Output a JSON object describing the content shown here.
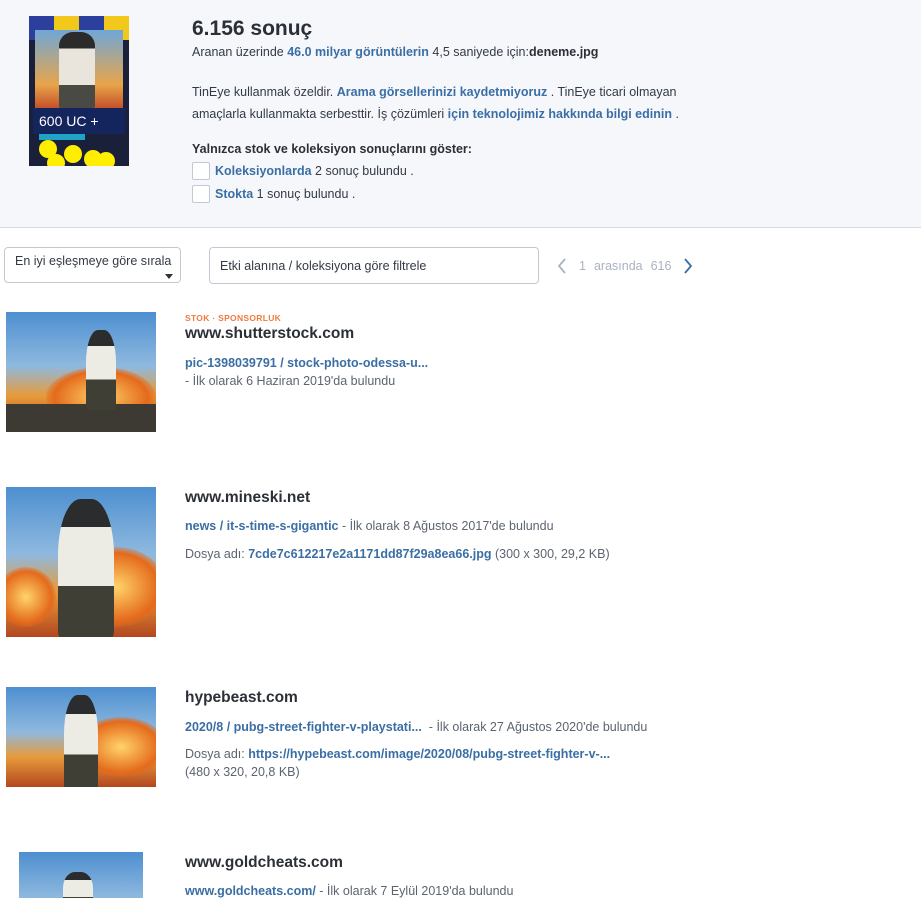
{
  "header": {
    "result_count": "6.156 sonuç",
    "searched_prefix": "Aranan üzerinde ",
    "searched_count": "46.0 milyar görüntülerin",
    "searched_suffix": " 4,5 saniyede için:",
    "query_file": "deneme.jpg",
    "query_thumb": {
      "price_text": "600 UC + ",
      "colors": {
        "dots": "#ffee00",
        "banner": "#14245c"
      }
    },
    "notice_1": "TinEye kullanmak özeldir. ",
    "notice_link_1": "Arama görsellerinizi kaydetmiyoruz",
    "notice_2": " . TinEye ticari olmayan amaçlarla kullanmakta serbesttir. İş çözümleri ",
    "notice_link_2": "için teknolojimiz hakkında bilgi edinin",
    "notice_3": " .",
    "stock_title": "Yalnızca stok ve koleksiyon sonuçlarını göster:",
    "filters": [
      {
        "link": "Koleksiyonlarda",
        "text": " 2 sonuç bulundu ."
      },
      {
        "link": "Stokta",
        "text": " 1 sonuç bulundu ."
      }
    ]
  },
  "toolbar": {
    "sort_label": "En iyi eşleşmeye göre sırala",
    "filter_placeholder": "Etki alanına / koleksiyona göre filtrele",
    "pager": {
      "current": "1",
      "between": "arasında",
      "total": "616"
    }
  },
  "results": [
    {
      "tags": "STOK · SPONSORLUK",
      "domain": "www.shutterstock.com",
      "link": "pic-1398039791 / stock-photo-odessa-u...",
      "found": "- İlk olarak 6 Haziran 2019'da bulundu"
    },
    {
      "domain": "www.mineski.net",
      "link": "news / it-s-time-s-gigantic",
      "found": " - İlk olarak 8 Ağustos 2017'de bulundu",
      "file_prefix": "Dosya adı: ",
      "file_name": "7cde7c612217e2a1171dd87f29a8ea66.jpg",
      "file_info": " (300 x 300, 29,2 KB)"
    },
    {
      "domain": "hypebeast.com",
      "link": "2020/8 / pubg-street-fighter-v-playstati...",
      "found": "  - İlk olarak 27 Ağustos 2020'de bulundu",
      "file_prefix": "Dosya adı: ",
      "file_name": "https://hypebeast.com/image/2020/08/pubg-street-fighter-v-...",
      "file_info": "(480 x 320, 20,8 KB)"
    },
    {
      "domain": "www.goldcheats.com",
      "link": "www.goldcheats.com/",
      "found": " - İlk olarak 7 Eylül 2019'da bulundu"
    }
  ]
}
